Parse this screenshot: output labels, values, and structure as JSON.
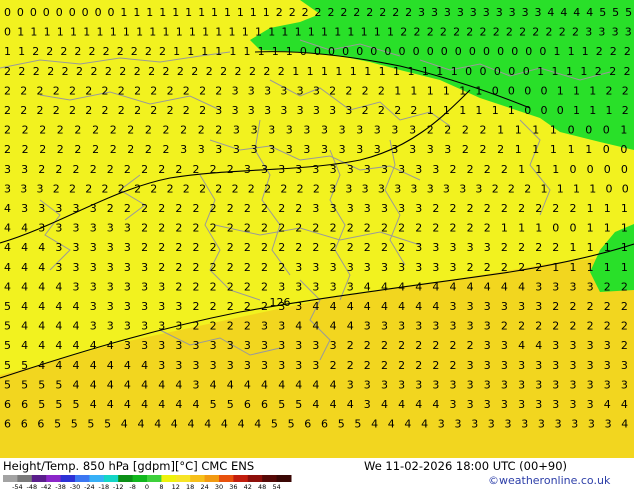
{
  "footer": {
    "title": "Height/Temp. 850 hPa [gdpm][°C] CMC ENS",
    "valid_time": "We 11-02-2026 18:00 UTC (00+90)",
    "credit": "©weatheronline.co.uk"
  },
  "colorbar": {
    "labels": [
      "-54",
      "-48",
      "-42",
      "-38",
      "-30",
      "-24",
      "-18",
      "-12",
      "-8",
      "0",
      "8",
      "12",
      "18",
      "24",
      "30",
      "36",
      "42",
      "48",
      "54"
    ],
    "colors": [
      "#a3a3a3",
      "#7a7a7a",
      "#5a1d8c",
      "#8b26c9",
      "#2d31d6",
      "#3b76f2",
      "#37b0f7",
      "#14d6c6",
      "#0b8f17",
      "#11b81e",
      "#3ed13c",
      "#eef20c",
      "#f7e426",
      "#f7c01a",
      "#f29a12",
      "#e8510d",
      "#c21d0d",
      "#8d0f0a",
      "#560907",
      "#3a0705"
    ]
  },
  "map": {
    "field_colors": {
      "cold_zone": "#29e029",
      "warm_zone": "#f2f21f",
      "warmer_zone": "#f2d61f"
    },
    "contour_label": "126",
    "value_rows": [
      "0000000001111111111112222222222233333333334444555",
      "011111111111111111111111111111222222222222223333",
      "112222222222111111111000000000000000000111222",
      "22222222222222222222111111111111000001111222",
      "222222222222223333332222111111000011122",
      "222222222222233333333322221111110001112",
      "222222222222233333333333222211110001",
      "222222222233333333333333332221111100",
      "3322222222222233333333333322221110000",
      "333222222222222222223333333333222111100",
      "4333332222222222223333333222222222111",
      "4433333322222222222222222222211100111",
      "4443333322222222222222223333322221111",
      "4443333332222222233333333332222211111",
      "4444333333222222333334444444444333322",
      "5444433333322222334444444433333322222",
      "5444433333322223344443333333322222222",
      "5444444333333333333322222222334433332",
      "5544444443333333333222222223333333333",
      "5555444444434444444433333333333333333",
      "6655544444445566554443444433333333344",
      "66655554444444445566554444333333333334"
    ]
  }
}
